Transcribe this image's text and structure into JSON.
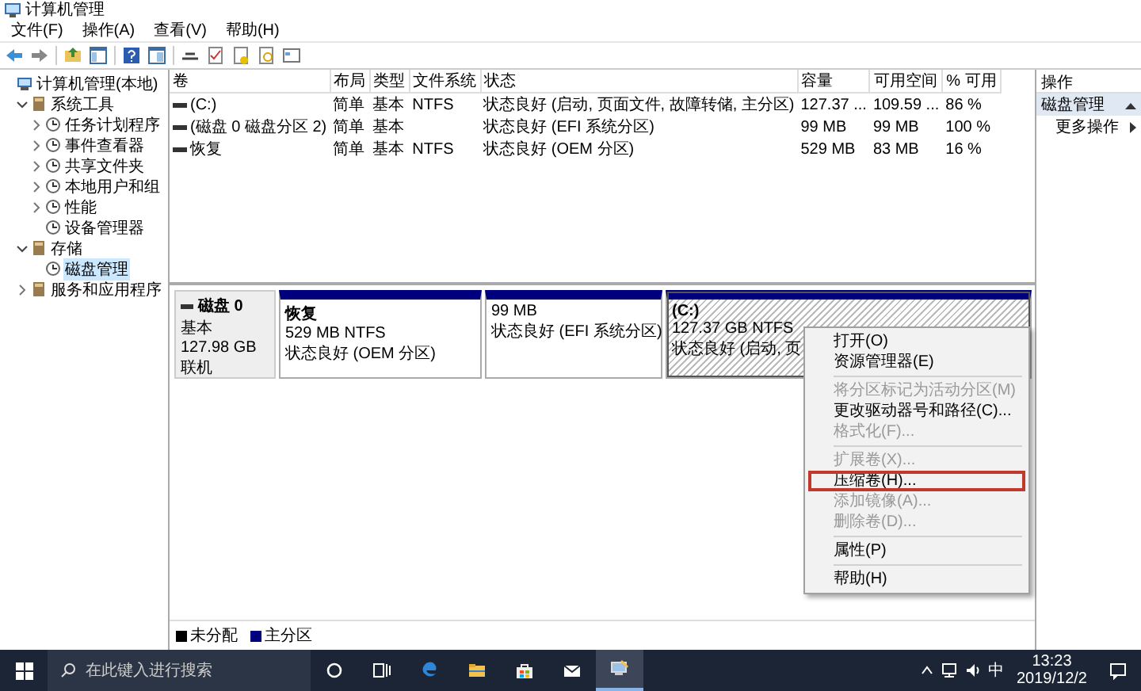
{
  "window": {
    "title": "计算机管理"
  },
  "menu_bar": [
    "文件(F)",
    "操作(A)",
    "查看(V)",
    "帮助(H)"
  ],
  "tree": [
    {
      "label": "计算机管理(本地)",
      "selected": false,
      "children": [
        {
          "label": "系统工具",
          "expanded": true,
          "selected": false,
          "children": [
            {
              "label": "任务计划程序",
              "expanded": false,
              "selected": false
            },
            {
              "label": "事件查看器",
              "expanded": false,
              "selected": false
            },
            {
              "label": "共享文件夹",
              "expanded": false,
              "selected": false
            },
            {
              "label": "本地用户和组",
              "expanded": false,
              "selected": false
            },
            {
              "label": "性能",
              "expanded": false,
              "selected": false
            },
            {
              "label": "设备管理器",
              "selected": false
            }
          ]
        },
        {
          "label": "存储",
          "expanded": true,
          "selected": false,
          "children": [
            {
              "label": "磁盘管理",
              "selected": true
            }
          ]
        },
        {
          "label": "服务和应用程序",
          "expanded": false,
          "selected": false
        }
      ]
    }
  ],
  "table": {
    "columns": [
      "卷",
      "布局",
      "类型",
      "文件系统",
      "状态",
      "容量",
      "可用空间",
      "% 可用"
    ],
    "rows": [
      [
        "(C:)",
        "简单",
        "基本",
        "NTFS",
        "状态良好 (启动, 页面文件, 故障转储, 主分区)",
        "127.37 ...",
        "109.59 ...",
        "86 %"
      ],
      [
        "(磁盘 0 磁盘分区 2)",
        "简单",
        "基本",
        "",
        "状态良好 (EFI 系统分区)",
        "99 MB",
        "99 MB",
        "100 %"
      ],
      [
        "恢复",
        "简单",
        "基本",
        "NTFS",
        "状态良好 (OEM 分区)",
        "529 MB",
        "83 MB",
        "16 %"
      ]
    ]
  },
  "disk": {
    "name": "磁盘 0",
    "type": "基本",
    "size": "127.98 GB",
    "status": "联机",
    "partitions": [
      {
        "name": "恢复",
        "size": "529 MB NTFS",
        "status": "状态良好 (OEM 分区)",
        "selected": false
      },
      {
        "size": "99 MB",
        "status": "状态良好 (EFI 系统分区)",
        "selected": false
      },
      {
        "name": "(C:)",
        "size": "127.37 GB NTFS",
        "status": "状态良好 (启动, 页",
        "selected": true
      }
    ]
  },
  "context_menu": [
    {
      "kind": "item",
      "label": "打开(O)",
      "disabled": false,
      "selected": false
    },
    {
      "kind": "item",
      "label": "资源管理器(E)",
      "disabled": false,
      "selected": false
    },
    {
      "kind": "separator"
    },
    {
      "kind": "item",
      "label": "将分区标记为活动分区(M)",
      "disabled": true,
      "selected": false
    },
    {
      "kind": "item",
      "label": "更改驱动器号和路径(C)...",
      "disabled": false,
      "selected": false
    },
    {
      "kind": "item",
      "label": "格式化(F)...",
      "disabled": true,
      "selected": false
    },
    {
      "kind": "separator"
    },
    {
      "kind": "item",
      "label": "扩展卷(X)...",
      "disabled": true,
      "selected": false
    },
    {
      "kind": "item",
      "label": "压缩卷(H)...",
      "disabled": false,
      "selected": true
    },
    {
      "kind": "item",
      "label": "添加镜像(A)...",
      "disabled": true,
      "selected": false
    },
    {
      "kind": "item",
      "label": "删除卷(D)...",
      "disabled": true,
      "selected": false
    },
    {
      "kind": "separator"
    },
    {
      "kind": "item",
      "label": "属性(P)",
      "disabled": false,
      "selected": false
    },
    {
      "kind": "separator"
    },
    {
      "kind": "item",
      "label": "帮助(H)",
      "disabled": false,
      "selected": false
    }
  ],
  "legend": [
    {
      "label": "未分配",
      "color": "#000000"
    },
    {
      "label": "主分区",
      "color": "#00007f"
    }
  ],
  "actions": {
    "title": "操作",
    "sections": [
      {
        "label": "磁盘管理",
        "expanded": true,
        "items": [
          "更多操作"
        ]
      }
    ]
  },
  "taskbar": {
    "search": {
      "placeholder": "在此键入进行搜索"
    },
    "apps": [
      {
        "kind": "cortana",
        "active": false
      },
      {
        "kind": "taskview",
        "active": false
      },
      {
        "kind": "edge",
        "active": false
      },
      {
        "kind": "explorer",
        "active": false
      },
      {
        "kind": "store",
        "active": false
      },
      {
        "kind": "mail",
        "active": false
      },
      {
        "kind": "compmgmt",
        "active": true
      }
    ],
    "ime": "中",
    "time": "13:23",
    "date": "2019/12/2"
  }
}
